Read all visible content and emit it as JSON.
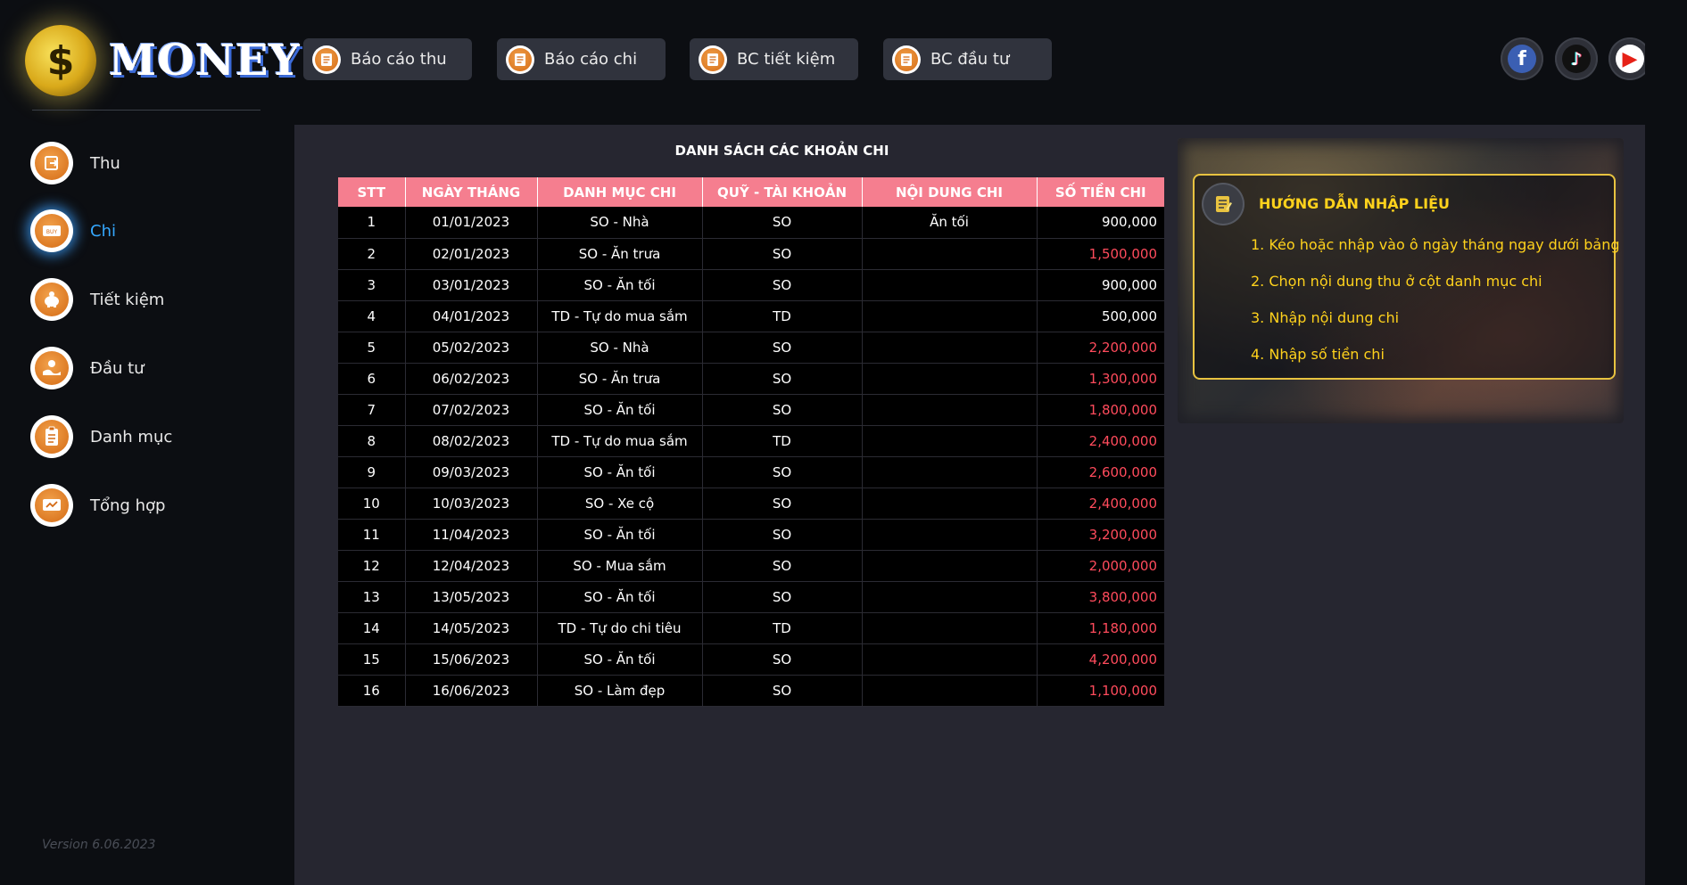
{
  "app": {
    "logo_text": "MONEY",
    "logo_symbol": "$",
    "version": "Version 6.06.2023"
  },
  "sidebar": {
    "items": [
      {
        "label": "Thu",
        "icon": "income-icon",
        "active": false
      },
      {
        "label": "Chi",
        "icon": "expense-icon",
        "active": true
      },
      {
        "label": "Tiết kiệm",
        "icon": "piggy-bank-icon",
        "active": false
      },
      {
        "label": "Đầu tư",
        "icon": "investment-icon",
        "active": false
      },
      {
        "label": "Danh mục",
        "icon": "clipboard-icon",
        "active": false
      },
      {
        "label": "Tổng hợp",
        "icon": "summary-icon",
        "active": false
      }
    ]
  },
  "toolbar": {
    "buttons": [
      {
        "label": "Báo cáo thu",
        "icon": "report-icon"
      },
      {
        "label": "Báo cáo chi",
        "icon": "report-icon"
      },
      {
        "label": "BC tiết kiệm",
        "icon": "report-icon"
      },
      {
        "label": "BC đầu tư",
        "icon": "report-icon"
      }
    ]
  },
  "social": [
    {
      "name": "facebook",
      "icon": "facebook-icon",
      "glyph": "f",
      "color": "#3b5fb3"
    },
    {
      "name": "tiktok",
      "icon": "tiktok-icon",
      "glyph": "♪",
      "color": "#111111"
    },
    {
      "name": "youtube",
      "icon": "youtube-icon",
      "glyph": "▶",
      "color": "#e62117"
    }
  ],
  "table": {
    "title": "DANH SÁCH CÁC KHOẢN CHI",
    "columns": [
      "STT",
      "NGÀY THÁNG",
      "DANH MỤC CHI",
      "QUỸ - TÀI KHOẢN",
      "NỘI DUNG CHI",
      "SỐ TIỀN CHI"
    ],
    "rows": [
      {
        "stt": "1",
        "date": "01/01/2023",
        "category": "SO - Nhà",
        "fund": "SO",
        "content": "Ăn tối",
        "amount": "900,000",
        "red": false
      },
      {
        "stt": "2",
        "date": "02/01/2023",
        "category": "SO - Ăn trưa",
        "fund": "SO",
        "content": "",
        "amount": "1,500,000",
        "red": true
      },
      {
        "stt": "3",
        "date": "03/01/2023",
        "category": "SO - Ăn tối",
        "fund": "SO",
        "content": "",
        "amount": "900,000",
        "red": false
      },
      {
        "stt": "4",
        "date": "04/01/2023",
        "category": "TD - Tự do mua sắm",
        "fund": "TD",
        "content": "",
        "amount": "500,000",
        "red": false
      },
      {
        "stt": "5",
        "date": "05/02/2023",
        "category": "SO - Nhà",
        "fund": "SO",
        "content": "",
        "amount": "2,200,000",
        "red": true
      },
      {
        "stt": "6",
        "date": "06/02/2023",
        "category": "SO - Ăn trưa",
        "fund": "SO",
        "content": "",
        "amount": "1,300,000",
        "red": true
      },
      {
        "stt": "7",
        "date": "07/02/2023",
        "category": "SO - Ăn tối",
        "fund": "SO",
        "content": "",
        "amount": "1,800,000",
        "red": true
      },
      {
        "stt": "8",
        "date": "08/02/2023",
        "category": "TD - Tự do mua sắm",
        "fund": "TD",
        "content": "",
        "amount": "2,400,000",
        "red": true
      },
      {
        "stt": "9",
        "date": "09/03/2023",
        "category": "SO - Ăn tối",
        "fund": "SO",
        "content": "",
        "amount": "2,600,000",
        "red": true
      },
      {
        "stt": "10",
        "date": "10/03/2023",
        "category": "SO - Xe cộ",
        "fund": "SO",
        "content": "",
        "amount": "2,400,000",
        "red": true
      },
      {
        "stt": "11",
        "date": "11/04/2023",
        "category": "SO - Ăn tối",
        "fund": "SO",
        "content": "",
        "amount": "3,200,000",
        "red": true
      },
      {
        "stt": "12",
        "date": "12/04/2023",
        "category": "SO - Mua sắm",
        "fund": "SO",
        "content": "",
        "amount": "2,000,000",
        "red": true
      },
      {
        "stt": "13",
        "date": "13/05/2023",
        "category": "SO - Ăn tối",
        "fund": "SO",
        "content": "",
        "amount": "3,800,000",
        "red": true
      },
      {
        "stt": "14",
        "date": "14/05/2023",
        "category": "TD - Tự do chi tiêu",
        "fund": "TD",
        "content": "",
        "amount": "1,180,000",
        "red": true
      },
      {
        "stt": "15",
        "date": "15/06/2023",
        "category": "SO - Ăn tối",
        "fund": "SO",
        "content": "",
        "amount": "4,200,000",
        "red": true
      },
      {
        "stt": "16",
        "date": "16/06/2023",
        "category": "SO - Làm đẹp",
        "fund": "SO",
        "content": "",
        "amount": "1,100,000",
        "red": true
      }
    ]
  },
  "guide": {
    "title": "HƯỚNG DẪN NHẬP LIỆU",
    "icon": "notepad-icon",
    "steps": [
      "1. Kéo hoặc nhập vào ô ngày tháng ngay dưới bảng",
      "2. Chọn nội dung thu ở cột danh mục chi",
      "3. Nhập nội dung chi",
      "4. Nhập số tiền chi"
    ]
  },
  "colors": {
    "header_pink": "#f57e8f",
    "amount_red": "#ff4b5c",
    "guide_yellow": "#ffd21c",
    "active_blue": "#35a8ff",
    "panel_bg": "#262630",
    "icon_orange": "#d46a14"
  }
}
